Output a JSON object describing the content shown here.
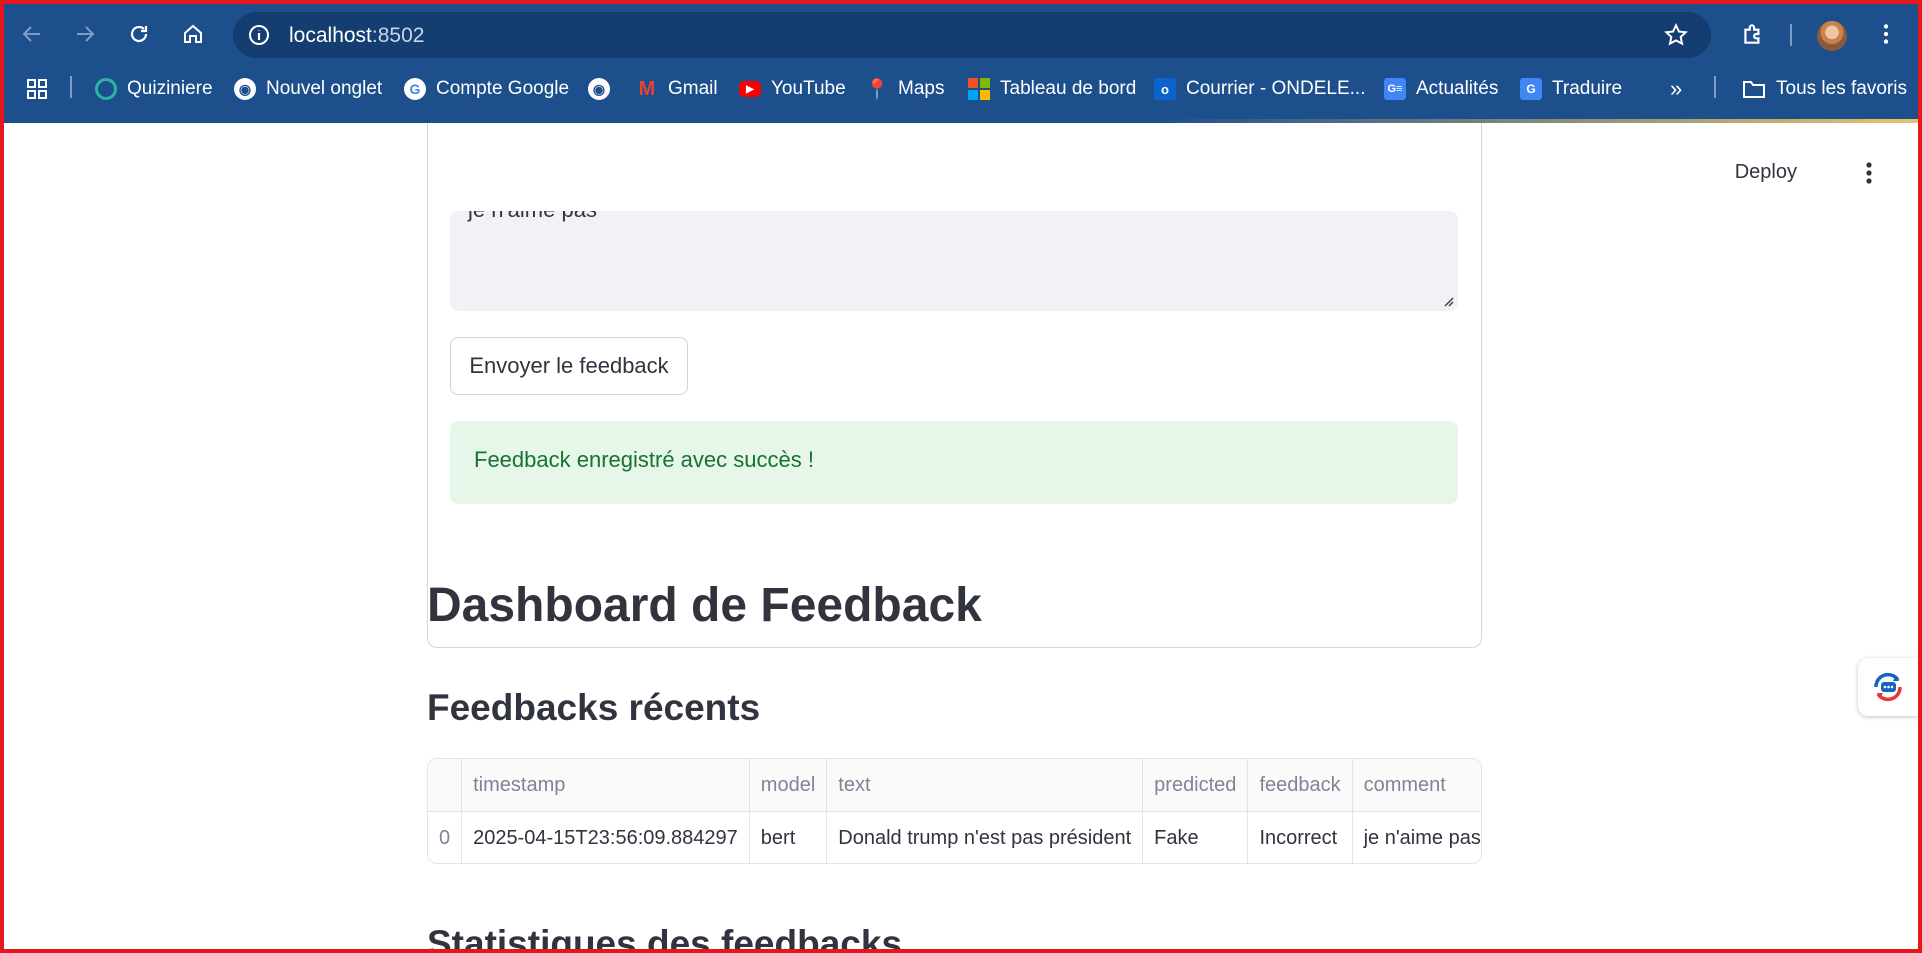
{
  "browser": {
    "url_host": "localhost",
    "url_port": ":8502",
    "bookmarks": [
      {
        "label": "Quiziniere",
        "icon": "quiziniere-icon",
        "color": "#2bb5a0"
      },
      {
        "label": "Nouvel onglet",
        "icon": "globe-icon",
        "color": "#ffffff"
      },
      {
        "label": "Compte Google",
        "icon": "google-icon",
        "color": "#ffffff"
      },
      {
        "label": "",
        "icon": "globe-icon",
        "color": "#ffffff"
      },
      {
        "label": "Gmail",
        "icon": "gmail-icon",
        "color": "#ea4335"
      },
      {
        "label": "YouTube",
        "icon": "youtube-icon",
        "color": "#ff0000"
      },
      {
        "label": "Maps",
        "icon": "maps-icon",
        "color": "#34a853"
      },
      {
        "label": "Tableau de bord",
        "icon": "microsoft-icon",
        "color": "#f25022"
      },
      {
        "label": "Courrier - ONDELE...",
        "icon": "outlook-icon",
        "color": "#0a64c9"
      },
      {
        "label": "Actualités",
        "icon": "news-icon",
        "color": "#4285f4"
      },
      {
        "label": "Traduire",
        "icon": "translate-icon",
        "color": "#4285f4"
      }
    ],
    "all_bookmarks_label": "Tous les favoris"
  },
  "app": {
    "deploy_label": "Deploy",
    "comment_value": "je n'aime pas",
    "send_button": "Envoyer le feedback",
    "success_message": "Feedback enregistré avec succès !",
    "dashboard_title": "Dashboard de Feedback",
    "recent_title": "Feedbacks récents",
    "stats_title": "Statistiques des feedbacks"
  },
  "table": {
    "columns": [
      "",
      "timestamp",
      "model",
      "text",
      "predicted",
      "feedback",
      "comment"
    ],
    "rows": [
      [
        "0",
        "2025-04-15T23:56:09.884297",
        "bert",
        "Donald trump n'est pas président",
        "Fake",
        "Incorrect",
        "je n'aime pas"
      ]
    ]
  },
  "colors": {
    "chrome": "#1c4f8c",
    "success_bg": "#e6f7ea",
    "success_text": "#177233",
    "frame": "#e5161e"
  }
}
